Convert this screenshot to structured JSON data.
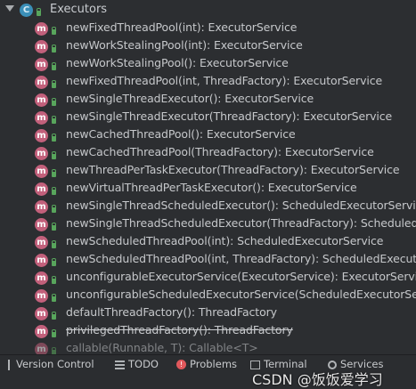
{
  "class_icon_letter": "C",
  "method_icon_letter": "m",
  "class_name": "Executors",
  "methods": [
    {
      "text": "newFixedThreadPool(int): ExecutorService",
      "deprecated": false
    },
    {
      "text": "newWorkStealingPool(int): ExecutorService",
      "deprecated": false
    },
    {
      "text": "newWorkStealingPool(): ExecutorService",
      "deprecated": false
    },
    {
      "text": "newFixedThreadPool(int, ThreadFactory): ExecutorService",
      "deprecated": false
    },
    {
      "text": "newSingleThreadExecutor(): ExecutorService",
      "deprecated": false
    },
    {
      "text": "newSingleThreadExecutor(ThreadFactory): ExecutorService",
      "deprecated": false
    },
    {
      "text": "newCachedThreadPool(): ExecutorService",
      "deprecated": false
    },
    {
      "text": "newCachedThreadPool(ThreadFactory): ExecutorService",
      "deprecated": false
    },
    {
      "text": "newThreadPerTaskExecutor(ThreadFactory): ExecutorService",
      "deprecated": false
    },
    {
      "text": "newVirtualThreadPerTaskExecutor(): ExecutorService",
      "deprecated": false
    },
    {
      "text": "newSingleThreadScheduledExecutor(): ScheduledExecutorService",
      "deprecated": false
    },
    {
      "text": "newSingleThreadScheduledExecutor(ThreadFactory): ScheduledExec",
      "deprecated": false
    },
    {
      "text": "newScheduledThreadPool(int): ScheduledExecutorService",
      "deprecated": false
    },
    {
      "text": "newScheduledThreadPool(int, ThreadFactory): ScheduledExecutorSe",
      "deprecated": false
    },
    {
      "text": "unconfigurableExecutorService(ExecutorService): ExecutorService",
      "deprecated": false
    },
    {
      "text": "unconfigurableScheduledExecutorService(ScheduledExecutorService",
      "deprecated": false
    },
    {
      "text": "defaultThreadFactory(): ThreadFactory",
      "deprecated": false
    },
    {
      "text": "privilegedThreadFactory(): ThreadFactory",
      "deprecated": true
    },
    {
      "text": "callable(Runnable, T): Callable<T>",
      "deprecated": false
    }
  ],
  "toolbar": {
    "version_control": "Version Control",
    "todo": "TODO",
    "problems": "Problems",
    "terminal": "Terminal",
    "services": "Services"
  },
  "watermark": "CSDN @饭饭爱学习",
  "colors": {
    "class_icon": "#3b8fb8",
    "method_icon": "#c2607b",
    "visibility_lock": "#58a55c",
    "background": "#2c2e31"
  }
}
